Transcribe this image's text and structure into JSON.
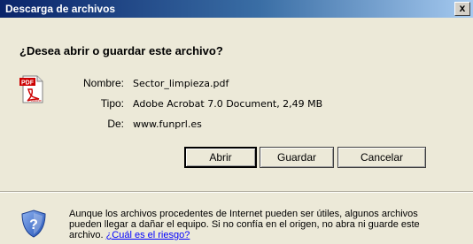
{
  "window": {
    "title": "Descarga de archivos",
    "close_label": "x"
  },
  "question": "¿Desea abrir o guardar este archivo?",
  "file": {
    "name_label": "Nombre:",
    "name_value": "Sector_limpieza.pdf",
    "type_label": "Tipo:",
    "type_value": "Adobe Acrobat 7.0 Document, 2,49 MB",
    "from_label": "De:",
    "from_value": "www.funprl.es",
    "icon": "pdf-file-icon",
    "icon_text": "PDF",
    "icon_subtext": "Adobe"
  },
  "buttons": {
    "open": "Abrir",
    "save": "Guardar",
    "cancel": "Cancelar"
  },
  "warning": {
    "icon": "shield-question-icon",
    "text": "Aunque los archivos procedentes de Internet pueden ser útiles, algunos archivos pueden llegar a dañar el equipo. Si no confía en el origen, no abra ni guarde este archivo. ",
    "link": "¿Cuál es el riesgo?"
  },
  "colors": {
    "titlebar_start": "#0a246a",
    "titlebar_end": "#a6caf0",
    "dialog_bg": "#ece9d8",
    "link": "#0000ff"
  }
}
